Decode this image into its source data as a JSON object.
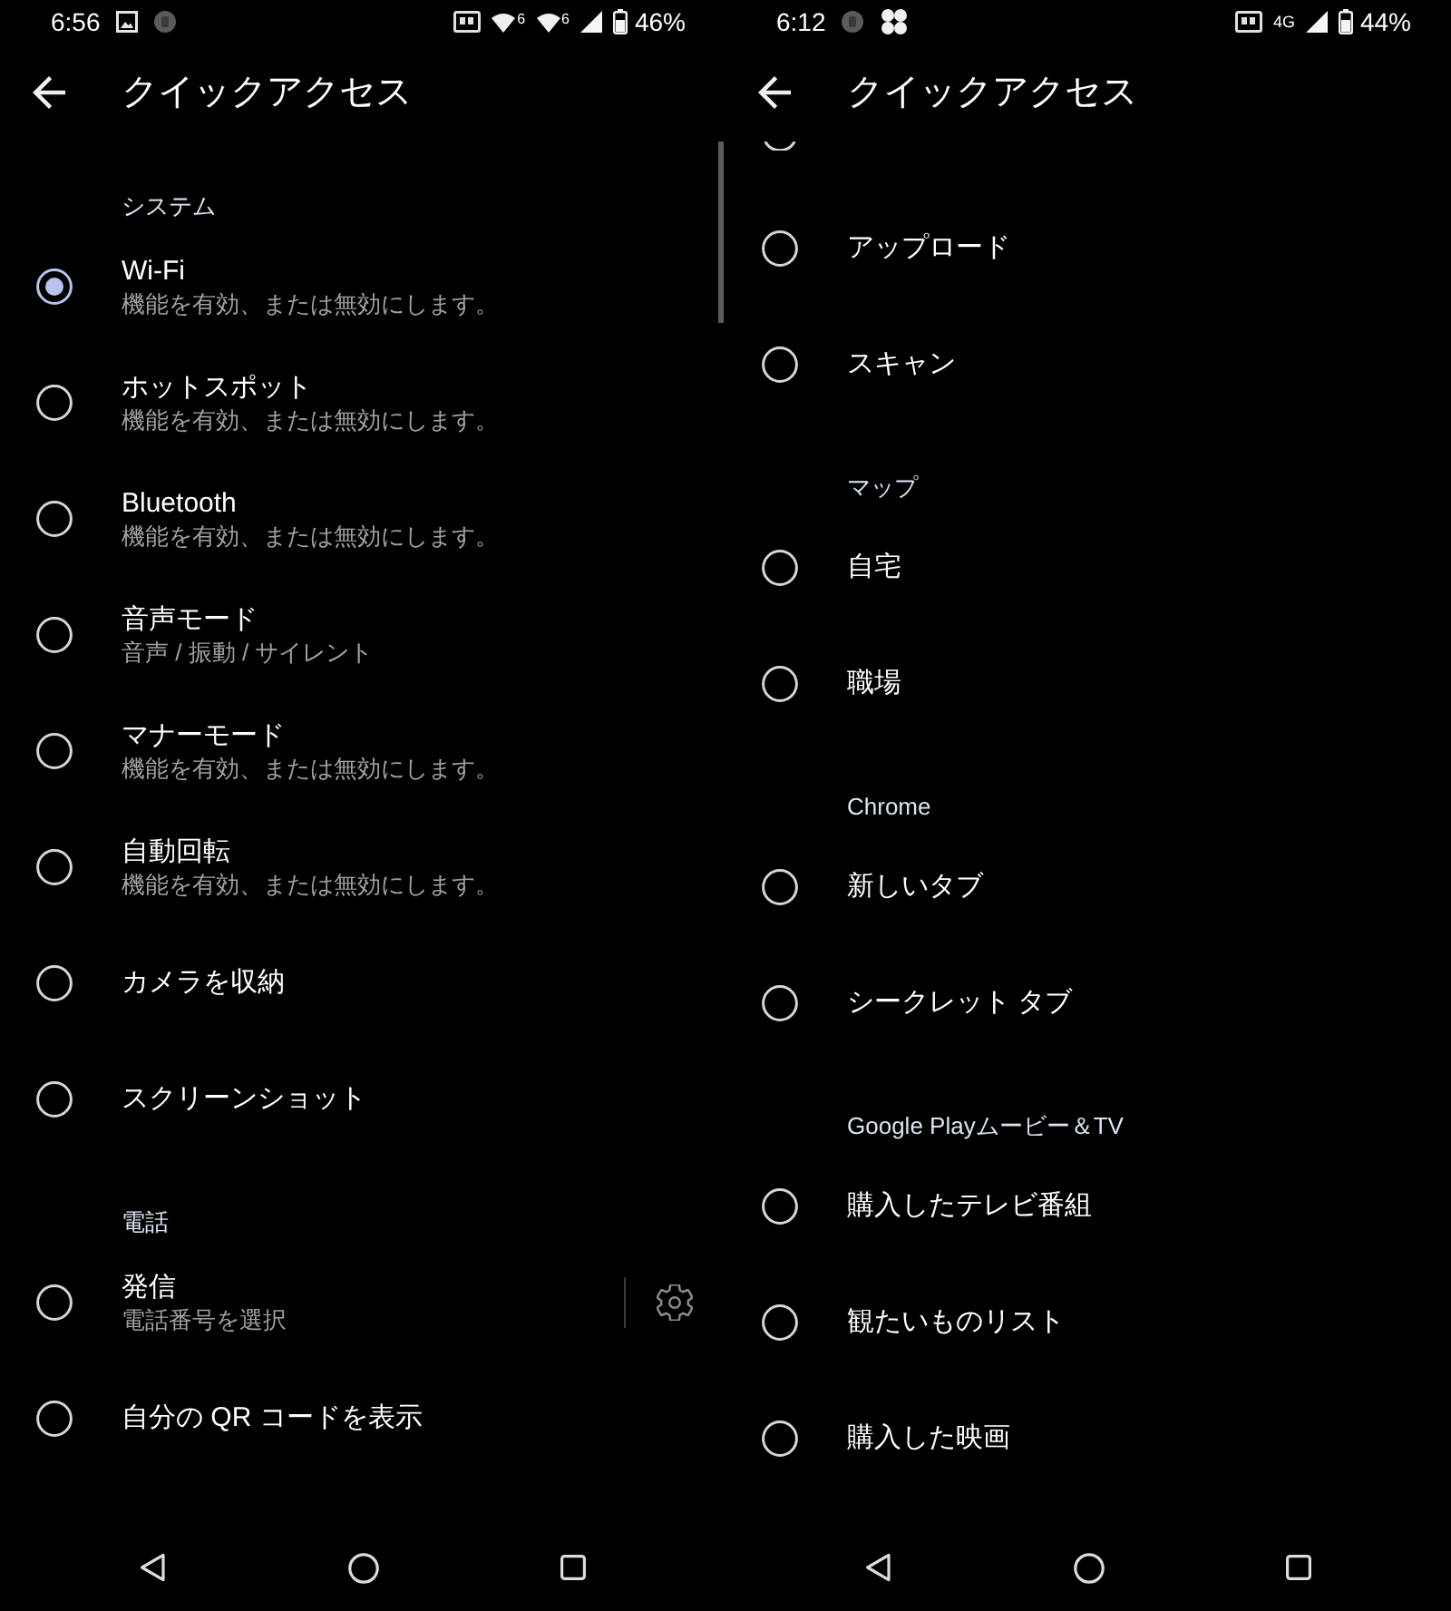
{
  "panels": [
    {
      "status_bar": {
        "time": "6:56",
        "icons": [
          {
            "kind": "gallery"
          },
          {
            "kind": "notification"
          }
        ],
        "indicators": [
          {
            "kind": "card"
          },
          {
            "kind": "wifi",
            "badge": "6"
          },
          {
            "kind": "wifi",
            "badge": "6"
          },
          {
            "kind": "signal"
          },
          {
            "kind": "battery"
          }
        ],
        "battery": "46%"
      },
      "app_bar": {
        "title": "クイックアクセス"
      },
      "scrollbar": true,
      "list": [
        {
          "kind": "header",
          "label": "システム"
        },
        {
          "kind": "option",
          "title": "Wi-Fi",
          "subtitle": "機能を有効、または無効にします。",
          "selected": true
        },
        {
          "kind": "option",
          "title": "ホットスポット",
          "subtitle": "機能を有効、または無効にします。",
          "selected": false
        },
        {
          "kind": "option",
          "title": "Bluetooth",
          "subtitle": "機能を有効、または無効にします。",
          "selected": false
        },
        {
          "kind": "option",
          "title": "音声モード",
          "subtitle": "音声 / 振動 / サイレント",
          "selected": false
        },
        {
          "kind": "option",
          "title": "マナーモード",
          "subtitle": "機能を有効、または無効にします。",
          "selected": false
        },
        {
          "kind": "option",
          "title": "自動回転",
          "subtitle": "機能を有効、または無効にします。",
          "selected": false
        },
        {
          "kind": "option",
          "title": "カメラを収納",
          "selected": false
        },
        {
          "kind": "option",
          "title": "スクリーンショット",
          "selected": false
        },
        {
          "kind": "header",
          "label": "電話"
        },
        {
          "kind": "option",
          "title": "発信",
          "subtitle": "電話番号を選択",
          "selected": false,
          "settings": true
        },
        {
          "kind": "option",
          "title": "自分の QR コードを表示",
          "selected": false
        }
      ],
      "nav_bar": [
        {
          "kind": "back"
        },
        {
          "kind": "home"
        },
        {
          "kind": "recents"
        }
      ]
    },
    {
      "status_bar": {
        "time": "6:12",
        "icons": [
          {
            "kind": "notification"
          },
          {
            "kind": "pinwheel"
          }
        ],
        "indicators": [
          {
            "kind": "card"
          },
          {
            "kind": "network",
            "label": "4G"
          },
          {
            "kind": "signal"
          },
          {
            "kind": "battery"
          }
        ],
        "battery": "44%"
      },
      "app_bar": {
        "title": "クイックアクセス"
      },
      "list": [
        {
          "kind": "clipped",
          "selected": false
        },
        {
          "kind": "option",
          "title": "アップロード",
          "selected": false
        },
        {
          "kind": "option",
          "title": "スキャン",
          "selected": false
        },
        {
          "kind": "header",
          "label": "マップ"
        },
        {
          "kind": "option",
          "title": "自宅",
          "selected": false
        },
        {
          "kind": "option",
          "title": "職場",
          "selected": false
        },
        {
          "kind": "header",
          "label": "Chrome"
        },
        {
          "kind": "option",
          "title": "新しいタブ",
          "selected": false
        },
        {
          "kind": "option",
          "title": "シークレット タブ",
          "selected": false
        },
        {
          "kind": "header",
          "label": "Google Playムービー＆TV"
        },
        {
          "kind": "option",
          "title": "購入したテレビ番組",
          "selected": false
        },
        {
          "kind": "option",
          "title": "観たいものリスト",
          "selected": false
        },
        {
          "kind": "option",
          "title": "購入した映画",
          "selected": false
        }
      ],
      "nav_bar": [
        {
          "kind": "back"
        },
        {
          "kind": "home"
        },
        {
          "kind": "recents"
        }
      ]
    }
  ]
}
